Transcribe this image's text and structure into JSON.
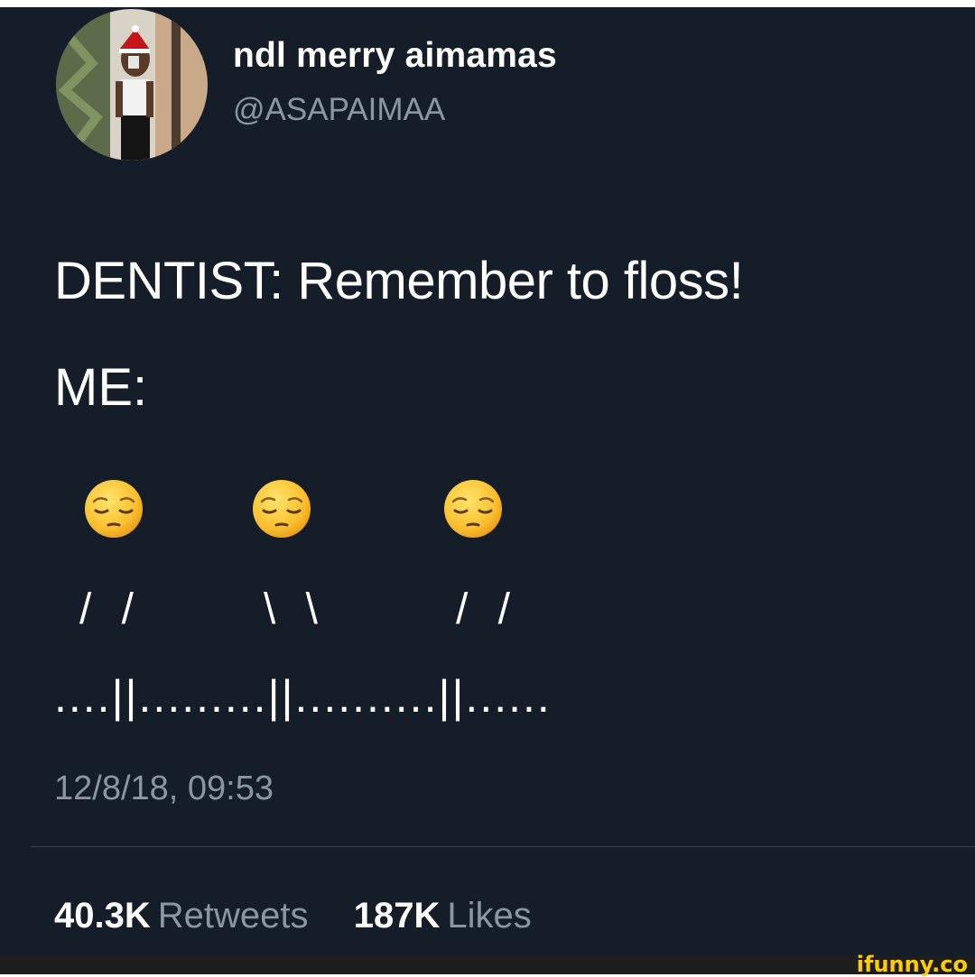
{
  "header": {
    "display_name": "ndl merry aimamas",
    "handle": "@ASAPAIMAA",
    "avatar_icon": "profile-photo-avatar"
  },
  "tweet": {
    "line1": "DENTIST: Remember to floss!",
    "line2": "ME:",
    "emoji_icon": "pensive-face-emoji",
    "slash_left": "/ /",
    "slash_middle": "\\ \\",
    "slash_right": "/ /",
    "floss_row": "....||.........||..........||......"
  },
  "meta": {
    "timestamp": "12/8/18, 09:53"
  },
  "stats": {
    "retweets_count": "40.3K",
    "retweets_label": "Retweets",
    "likes_count": "187K",
    "likes_label": "Likes"
  },
  "watermark": "ifunny.co",
  "colors": {
    "background": "#151d29",
    "text_primary": "#ffffff",
    "text_secondary": "#8b96a3",
    "divider": "#37404b",
    "watermark": "#ffcc00"
  }
}
